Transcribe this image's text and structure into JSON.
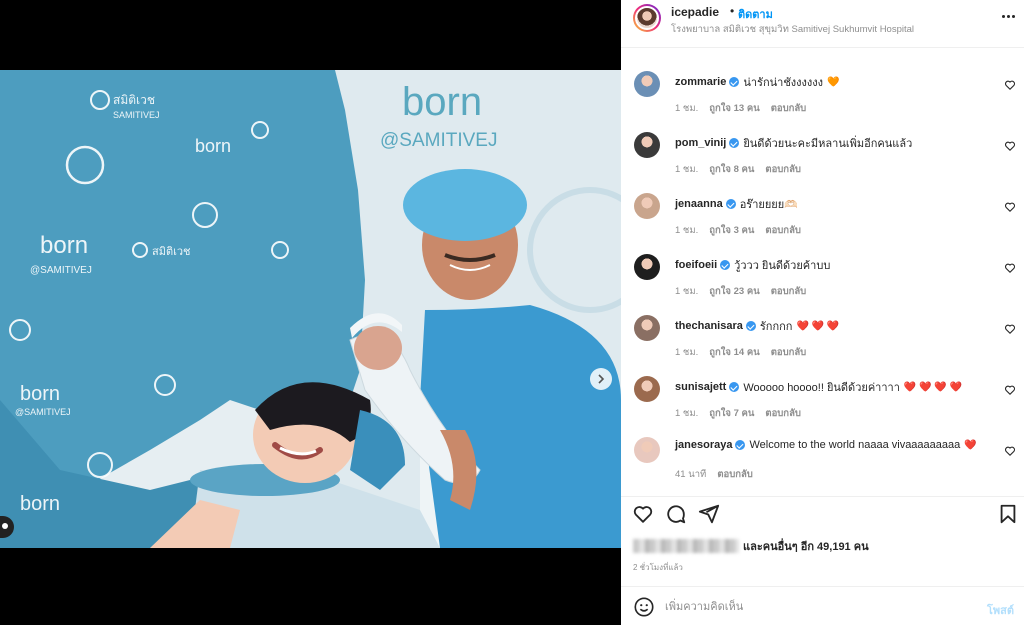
{
  "post": {
    "owner": "icepadie",
    "dot": "•",
    "follow_label": "ติดตาม",
    "location": "โรงพยาบาล สมิติเวช สุขุมวิท Samitivej Sukhumvit Hospital"
  },
  "photo": {
    "brand_logo": "born",
    "brand_handle": "@SAMITIVEJ",
    "hospital_thai": "สมิติเวช",
    "hospital_en": "SAMITIVEJ"
  },
  "comments": [
    {
      "user": "zommarie",
      "verified": true,
      "text": "น่ารักน่าชังงงงงง",
      "emoji": "🧡",
      "time": "1 ชม.",
      "likes": "ถูกใจ 13 คน",
      "reply": "ตอบกลับ",
      "avatar_color": "#6b8fb5"
    },
    {
      "user": "pom_vinij",
      "verified": true,
      "text": "ยินดีด้วยนะคะมีหลานเพิ่มอีกคนแล้ว",
      "emoji": "",
      "time": "1 ชม.",
      "likes": "ถูกใจ 8 คน",
      "reply": "ตอบกลับ",
      "avatar_color": "#3a3a3a"
    },
    {
      "user": "jenaanna",
      "verified": true,
      "text": "อร๊ายยยย🫶🏻",
      "emoji": "",
      "time": "1 ชม.",
      "likes": "ถูกใจ 3 คน",
      "reply": "ตอบกลับ",
      "avatar_color": "#c9a58d"
    },
    {
      "user": "foeifoeii",
      "verified": true,
      "text": "วู้ววว ยินดีด้วยค้าบบ",
      "emoji": "",
      "time": "1 ชม.",
      "likes": "ถูกใจ 23 คน",
      "reply": "ตอบกลับ",
      "avatar_color": "#1e1e1e"
    },
    {
      "user": "thechanisara",
      "verified": true,
      "text": "รักกกก",
      "emoji": "❤️ ❤️ ❤️",
      "time": "1 ชม.",
      "likes": "ถูกใจ 14 คน",
      "reply": "ตอบกลับ",
      "avatar_color": "#8a6f63"
    },
    {
      "user": "sunisajett",
      "verified": true,
      "text": "Wooooo hoooo!! ยินดีด้วยค่าาาา",
      "emoji": "❤️ ❤️ ❤️ ❤️",
      "time": "1 ชม.",
      "likes": "ถูกใจ 7 คน",
      "reply": "ตอบกลับ",
      "avatar_color": "#9b6a4e"
    },
    {
      "user": "janesoraya",
      "verified": true,
      "text": "Welcome to the world naaaa vivaaaaaaaaa",
      "emoji": "❤️",
      "time": "41 นาที",
      "likes": "",
      "reply": "ตอบกลับ",
      "avatar_color": "#e8c8be"
    }
  ],
  "likes_summary": {
    "prefix_blurred": true,
    "text": "และคนอื่นๆ อีก 49,191 คน"
  },
  "time_ago": "2 ชั่วโมงที่แล้ว",
  "comment_box": {
    "placeholder": "เพิ่มความคิดเห็น",
    "post_label": "โพสต์"
  },
  "colors": {
    "accent": "#0095f6",
    "verified": "#3897f0",
    "muted": "#8e8e8e",
    "text": "#262626",
    "heart": "#ed4956"
  },
  "icons": [
    "heart-icon",
    "comment-icon",
    "share-icon",
    "bookmark-icon",
    "emoji-icon",
    "more-icon",
    "chevron-right-icon",
    "user-tag-icon",
    "verified-icon"
  ]
}
